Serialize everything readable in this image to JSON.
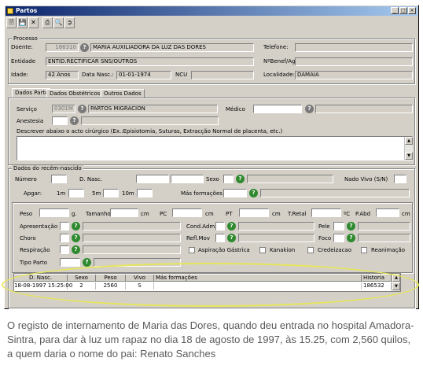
{
  "window": {
    "title": "Partos",
    "controls": [
      "_",
      "□",
      "×"
    ]
  },
  "toolbar": {
    "buttons": [
      "new-icon",
      "save-icon",
      "close-icon",
      "print-icon",
      "preview-icon",
      "exit-icon"
    ]
  },
  "processo": {
    "legend": "Processo",
    "doente_label": "Doente:",
    "doente_id": "186310",
    "doente_nome": "MARIA AUXILIADORA DA LUZ DAS DORES",
    "telefone_label": "Telefone:",
    "entidade_label": "Entidade",
    "entidade_value": "ENTID.RECTIFICAR SNS/OUTROS",
    "nbenef_label": "NºBenef/Ag",
    "idade_label": "Idade:",
    "idade_value": "42 Anos",
    "dnasc_label": "Data Nasc.:",
    "dnasc_value": "01-01-1974",
    "ncu_label": "NCU",
    "localidade_label": "Localidade:",
    "localidade_value": "DAMAIA"
  },
  "tabs": [
    "Dados Parto",
    "Dados Obstétricos",
    "Outros Dados"
  ],
  "dados_parto": {
    "servico_label": "Serviço",
    "servico_code": "0301M",
    "servico_name": "PARTOS MIGRACION",
    "medico_label": "Médico",
    "anestesia_label": "Anestesia",
    "descrever_label": "Descrever abaixo o acto cirúrgico (Ex.:Episiotomia, Suturas, Extracção Normal de placenta, etc.)"
  },
  "recem_nascido": {
    "legend": "Dados do recém-nascido",
    "numero_label": "Número",
    "dnasc_label": "D. Nasc.",
    "sexo_label": "Sexo",
    "nado_vivo_label": "Nado Vivo (S/N)",
    "apgar_label": "Apgar:",
    "apgar_1m": "1m",
    "apgar_5m": "5m",
    "apgar_10m": "10m",
    "malformacoes_label": "Más formações",
    "peso_label": "Peso",
    "peso_unit": "g.",
    "tamanho_label": "Tamanho",
    "tamanho_unit": "cm",
    "pc_label": "PC",
    "pc_unit": "cm",
    "pt_label": "PT",
    "pt_unit": "cm",
    "tretal_label": "T.Retal",
    "tretal_unit": "ºC",
    "pabd_label": "P.Abd",
    "pabd_unit": "cm",
    "apresentacao_label": "Apresentação",
    "cond_adm_label": "Cond.Adm.",
    "pele_label": "Pele",
    "choro_label": "Choro",
    "refl_mov_label": "Refl.Mov",
    "foco_label": "Foco",
    "respiracao_label": "Respiração",
    "aspiracao_label": "Aspiração Gástrica",
    "kanakion_label": "Kanakion",
    "credeizacao_label": "Credeizacao",
    "reanimacao_label": "Reanimação",
    "tipo_parto_label": "Tipo Parto"
  },
  "table": {
    "headers": [
      "D. Nasc.",
      "Sexo",
      "Peso",
      "Vivo",
      "Más formações",
      "Historia"
    ],
    "rows": [
      [
        "18-08-1997 15:25:00",
        "2",
        "2560",
        "S",
        "",
        "186532"
      ]
    ]
  },
  "caption": "O registo de internamento de Maria das Dores, quando deu entrada no hospital Amadora-Sintra, para dar à luz um rapaz no dia 18 de agosto de 1997, às 15.25, com 2,560 quilos, a quem daria o nome do pai: Renato Sanches",
  "colors": {
    "titlebar_start": "#0a246a",
    "titlebar_end": "#a6caf0",
    "highlight_ellipse": "#e6e65a",
    "help_green": "#2f8a2f"
  }
}
